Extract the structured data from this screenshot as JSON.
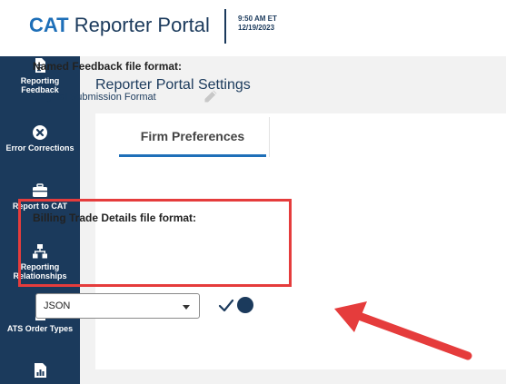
{
  "header": {
    "brand_prefix": "CAT",
    "brand_suffix": " Reporter Portal",
    "time": "9:50 AM ET",
    "date": "12/19/2023"
  },
  "sidebar": {
    "items": [
      {
        "label": "Reporting Feedback",
        "icon": "document-icon"
      },
      {
        "label": "Error Corrections",
        "icon": "error-x-icon"
      },
      {
        "label": "Report to CAT",
        "icon": "briefcase-icon"
      },
      {
        "label": "Reporting Relationships",
        "icon": "hierarchy-icon"
      },
      {
        "label": "ATS Order Types",
        "icon": "file-icon"
      },
      {
        "label": "",
        "icon": "chart-report-icon"
      }
    ]
  },
  "main": {
    "page_title": "Reporter Portal Settings",
    "tab_label": "Firm Preferences",
    "named_feedback_label": "Named Feedback file format:",
    "named_feedback_value": "Original Submission Format",
    "billing_label": "Billing Trade Details file format:",
    "billing_select_value": "JSON"
  },
  "colors": {
    "sidebar_bg": "#1b3a5c",
    "accent_blue": "#1e6fb8",
    "highlight_red": "#e53c3c"
  }
}
